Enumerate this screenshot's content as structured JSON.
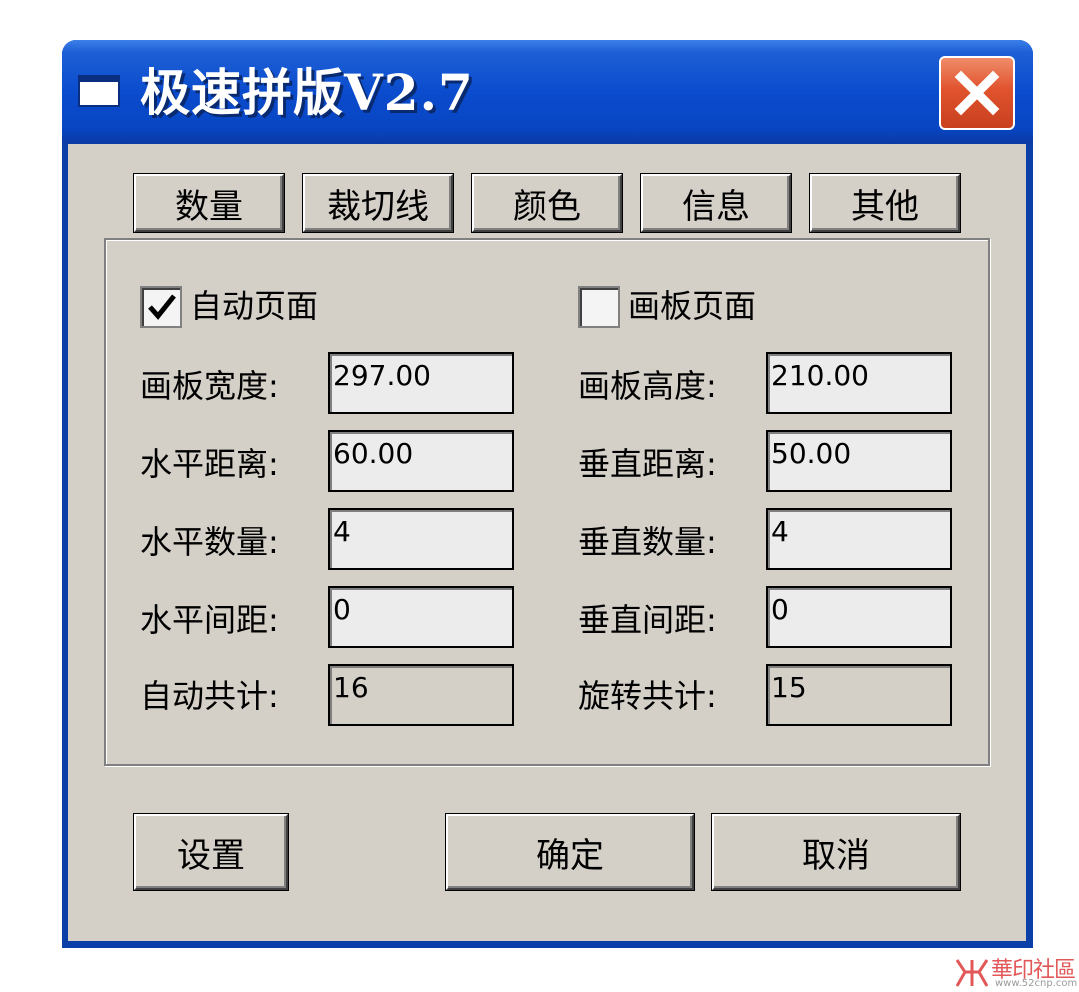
{
  "window": {
    "title": "极速拼版V2.7"
  },
  "tabs": [
    {
      "label": "数量"
    },
    {
      "label": "裁切线"
    },
    {
      "label": "颜色"
    },
    {
      "label": "信息"
    },
    {
      "label": "其他"
    }
  ],
  "form": {
    "auto_page": {
      "label": "自动页面",
      "checked": true
    },
    "board_page": {
      "label": "画板页面",
      "checked": false
    },
    "board_width": {
      "label": "画板宽度:",
      "value": "297.00"
    },
    "board_height": {
      "label": "画板高度:",
      "value": "210.00"
    },
    "h_distance": {
      "label": "水平距离:",
      "value": "60.00"
    },
    "v_distance": {
      "label": "垂直距离:",
      "value": "50.00"
    },
    "h_count": {
      "label": "水平数量:",
      "value": "4"
    },
    "v_count": {
      "label": "垂直数量:",
      "value": "4"
    },
    "h_gap": {
      "label": "水平间距:",
      "value": "0"
    },
    "v_gap": {
      "label": "垂直间距:",
      "value": "0"
    },
    "auto_total": {
      "label": "自动共计:",
      "value": "16"
    },
    "rotate_total": {
      "label": "旋转共计:",
      "value": "15"
    }
  },
  "buttons": {
    "settings": "设置",
    "ok": "确定",
    "cancel": "取消"
  },
  "watermark": {
    "text": "華印社區",
    "url": "www.52cnp.com"
  },
  "colors": {
    "titlebar": "#0a4ccd",
    "dialog_face": "#d4d0c8",
    "close_button": "#e0532d"
  }
}
